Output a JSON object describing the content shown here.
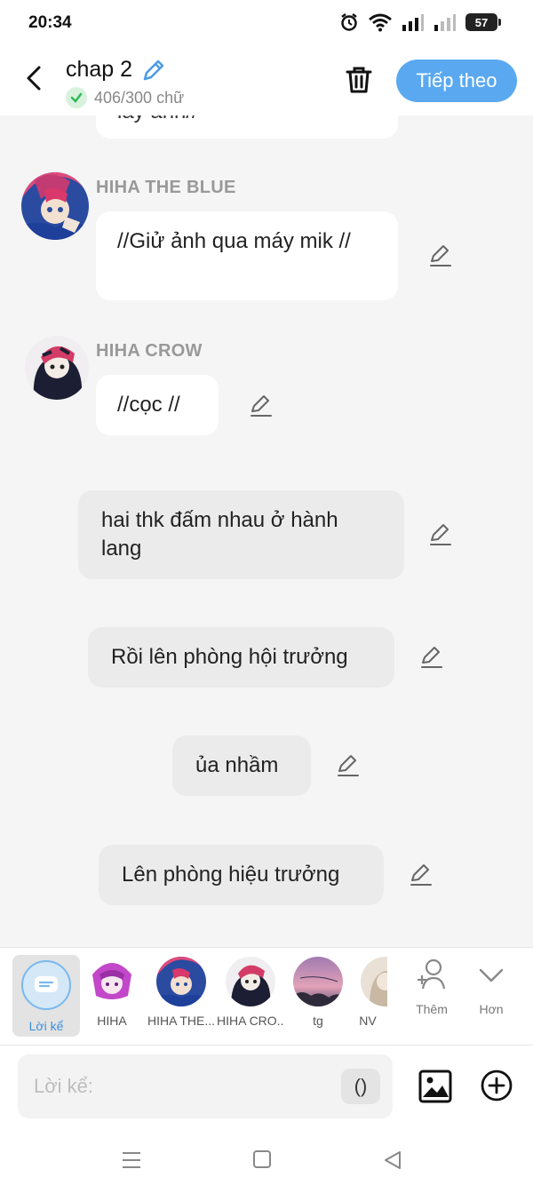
{
  "status": {
    "time": "20:34",
    "battery": "57"
  },
  "header": {
    "title": "chap 2",
    "word_count": "406/300 chữ",
    "next_label": "Tiếp theo"
  },
  "messages": [
    {
      "type": "char",
      "text": "lấy anh//",
      "partial": true
    },
    {
      "type": "char",
      "speaker": "HIHA THE BLUE",
      "text": "//Giử ảnh qua máy mik //"
    },
    {
      "type": "char",
      "speaker": "HIHA CROW",
      "text": "//cọc //"
    },
    {
      "type": "narration",
      "text": "hai thk đấm nhau ở hành lang"
    },
    {
      "type": "narration",
      "text": "Rồi lên phòng hội trưởng"
    },
    {
      "type": "narration",
      "text": "ủa nhầm"
    },
    {
      "type": "narration",
      "text": "Lên phòng hiệu trưởng"
    }
  ],
  "charbar": {
    "narrator_label": "Lời kể",
    "characters": [
      "HIHA",
      "HIHA THE...",
      "HIHA CRO...",
      "tg",
      "NV"
    ],
    "add_label": "Thêm",
    "more_label": "Hơn"
  },
  "input": {
    "placeholder": "Lời kể:",
    "paren_label": "()"
  },
  "colors": {
    "accent": "#5aa9f0",
    "narration_bg": "#ebebeb",
    "check_green": "#2dbb55"
  }
}
